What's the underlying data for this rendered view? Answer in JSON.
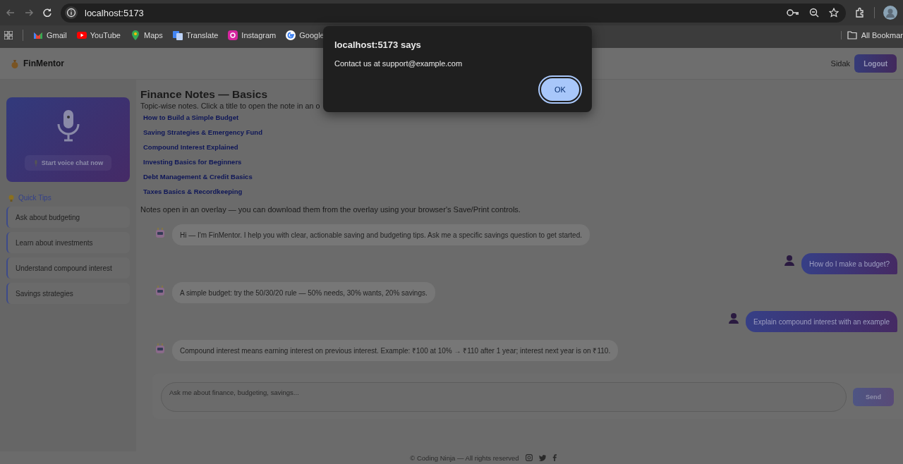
{
  "browser": {
    "url": "localhost:5173",
    "bookmarks": [
      {
        "label": "Gmail",
        "kind": "gmail"
      },
      {
        "label": "YouTube",
        "kind": "youtube"
      },
      {
        "label": "Maps",
        "kind": "maps"
      },
      {
        "label": "Translate",
        "kind": "translate"
      },
      {
        "label": "Instagram",
        "kind": "instagram"
      },
      {
        "label": "Google",
        "kind": "google"
      }
    ],
    "all_bookmarks": "All Bookmar"
  },
  "dialog": {
    "title": "localhost:5173 says",
    "message": "Contact us at support@example.com",
    "button": "OK"
  },
  "header": {
    "logo": "FinMentor",
    "user": "Sidak",
    "logout": "Logout"
  },
  "sidebar": {
    "voice_button": "Start voice chat now",
    "tips_title": "Quick Tips",
    "tips": [
      "Ask about budgeting",
      "Learn about investments",
      "Understand compound interest",
      "Savings strategies"
    ]
  },
  "notes": {
    "title": "Finance Notes — Basics",
    "subtitle": "Topic-wise notes. Click a title to open the note in an o",
    "links": [
      "How to Build a Simple Budget",
      "Saving Strategies & Emergency Fund",
      "Compound Interest Explained",
      "Investing Basics for Beginners",
      "Debt Management & Credit Basics",
      "Taxes Basics & Recordkeeping"
    ],
    "footnote": "Notes open in an overlay — you can download them from the overlay using your browser's Save/Print controls."
  },
  "chat": {
    "messages": [
      {
        "kind": "bot",
        "text": "Hi — I'm FinMentor. I help you with clear, actionable saving and budgeting tips. Ask me a specific savings question to get started."
      },
      {
        "kind": "user",
        "text": "How do I make a budget?"
      },
      {
        "kind": "bot",
        "text": "A simple budget: try the 50/30/20 rule — 50% needs, 30% wants, 20% savings."
      },
      {
        "kind": "user",
        "text": "Explain compound interest with an example"
      },
      {
        "kind": "bot",
        "text": "Compound interest means earning interest on previous interest. Example: ₹100 at 10% → ₹110 after 1 year; interest next year is on ₹110."
      }
    ],
    "input": {
      "placeholder": "Ask me about finance, budgeting, savings..."
    },
    "send": "Send"
  },
  "footer": {
    "text": "© Coding Ninja — All rights reserved"
  }
}
